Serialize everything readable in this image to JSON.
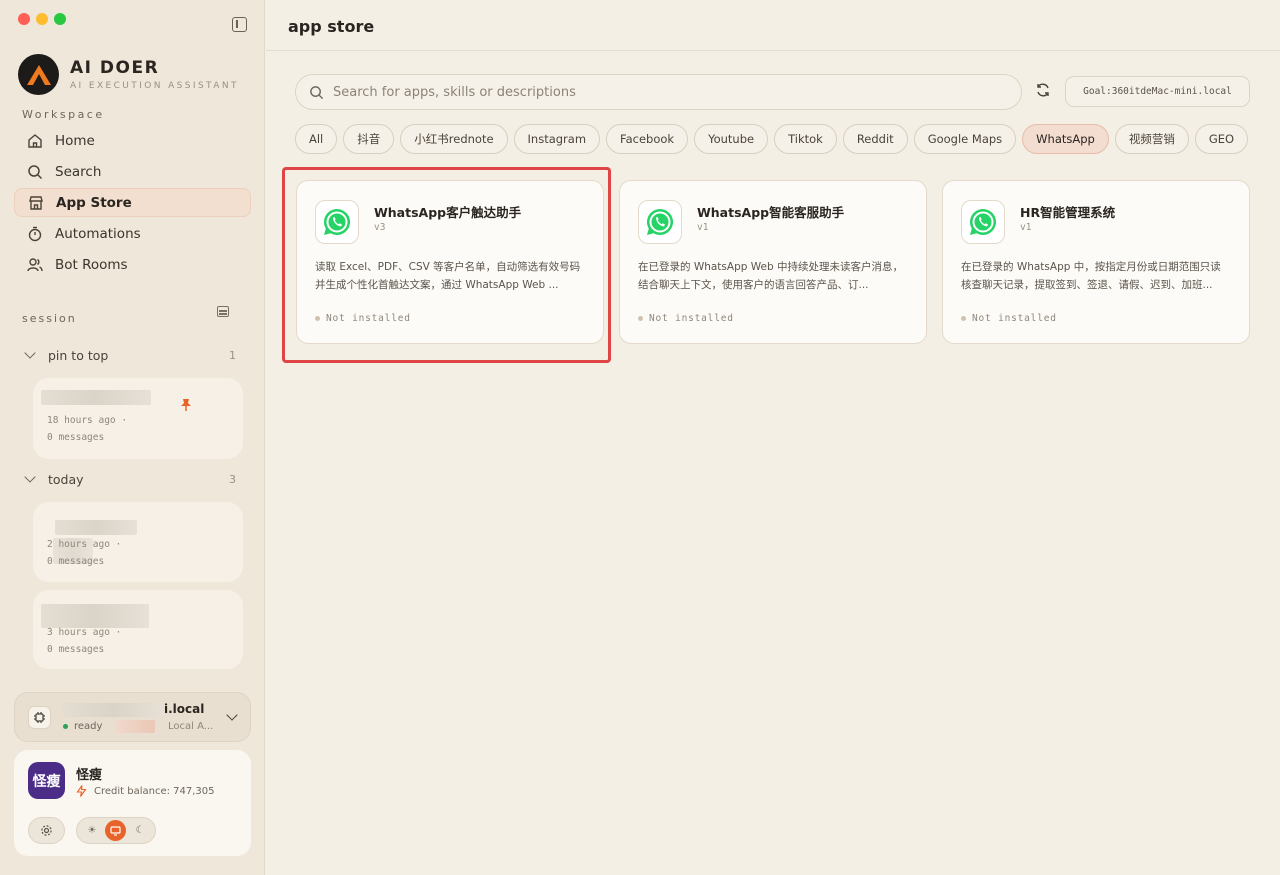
{
  "brand": {
    "name": "AI DOER",
    "subtitle": "AI EXECUTION ASSISTANT"
  },
  "sidebar": {
    "workspace_label": "Workspace",
    "nav": [
      {
        "label": "Home",
        "icon": "home-icon"
      },
      {
        "label": "Search",
        "icon": "search-icon"
      },
      {
        "label": "App Store",
        "icon": "store-icon",
        "active": true
      },
      {
        "label": "Automations",
        "icon": "timer-icon"
      },
      {
        "label": "Bot Rooms",
        "icon": "users-icon"
      }
    ],
    "session_label": "session",
    "groups": [
      {
        "title": "pin to top",
        "count": "1"
      },
      {
        "title": "today",
        "count": "3"
      }
    ],
    "sessions": [
      {
        "time": "18 hours ago ·",
        "messages": "0 messages"
      },
      {
        "time": "2 hours ago ·",
        "messages": "0 messages"
      },
      {
        "time": "3 hours ago ·",
        "messages": "0 messages"
      }
    ],
    "environment": {
      "host": "i.local",
      "status": "ready",
      "mode": "Local A..."
    },
    "user": {
      "avatar_text": "怪瘦",
      "name": "怪瘦",
      "credit": "Credit balance: 747,305"
    }
  },
  "main": {
    "title": "app store",
    "search_placeholder": "Search for apps, skills or descriptions",
    "goal": "Goal:360itdeMac-mini.local",
    "filters": [
      "All",
      "抖音",
      "小红书rednote",
      "Instagram",
      "Facebook",
      "Youtube",
      "Tiktok",
      "Reddit",
      "Google Maps",
      "WhatsApp",
      "视频营销",
      "GEO"
    ],
    "active_filter": "WhatsApp",
    "apps": [
      {
        "title": "WhatsApp客户触达助手",
        "version": "v3",
        "description": "读取 Excel、PDF、CSV 等客户名单，自动筛选有效号码并生成个性化首触达文案，通过 WhatsApp Web ...",
        "status": "Not installed"
      },
      {
        "title": "WhatsApp智能客服助手",
        "version": "v1",
        "description": "在已登录的 WhatsApp Web 中持续处理未读客户消息，结合聊天上下文，使用客户的语言回答产品、订...",
        "status": "Not installed"
      },
      {
        "title": "HR智能管理系统",
        "version": "v1",
        "description": "在已登录的 WhatsApp 中，按指定月份或日期范围只读核查聊天记录，提取签到、签退、请假、迟到、加班...",
        "status": "Not installed"
      }
    ]
  },
  "colors": {
    "accent": "#e8632a",
    "whatsapp": "#25d366",
    "highlight": "#e04545",
    "ready": "#2e9e5b"
  }
}
